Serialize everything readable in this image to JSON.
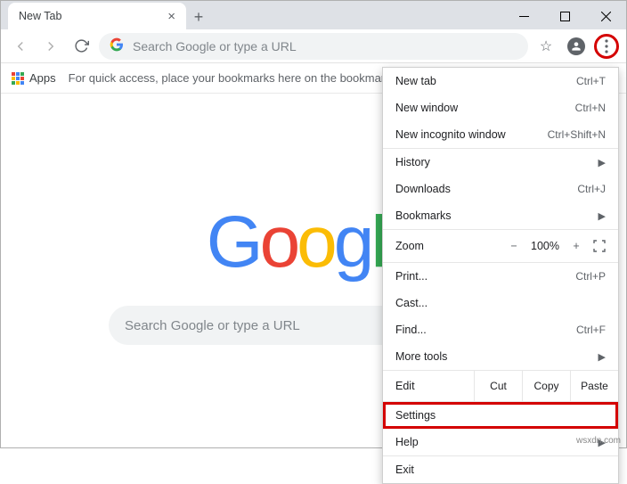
{
  "window": {
    "tab_title": "New Tab"
  },
  "toolbar": {
    "omnibox_placeholder": "Search Google or type a URL"
  },
  "bookmarks_bar": {
    "apps_label": "Apps",
    "hint": "For quick access, place your bookmarks here on the bookmarks ba"
  },
  "ntp": {
    "search_placeholder": "Search Google or type a URL"
  },
  "menu": {
    "new_tab": {
      "label": "New tab",
      "shortcut": "Ctrl+T"
    },
    "new_window": {
      "label": "New window",
      "shortcut": "Ctrl+N"
    },
    "incognito": {
      "label": "New incognito window",
      "shortcut": "Ctrl+Shift+N"
    },
    "history": {
      "label": "History"
    },
    "downloads": {
      "label": "Downloads",
      "shortcut": "Ctrl+J"
    },
    "bookmarks": {
      "label": "Bookmarks"
    },
    "zoom": {
      "label": "Zoom",
      "minus": "−",
      "value": "100%",
      "plus": "+"
    },
    "print": {
      "label": "Print...",
      "shortcut": "Ctrl+P"
    },
    "cast": {
      "label": "Cast..."
    },
    "find": {
      "label": "Find...",
      "shortcut": "Ctrl+F"
    },
    "more_tools": {
      "label": "More tools"
    },
    "edit": {
      "label": "Edit",
      "cut": "Cut",
      "copy": "Copy",
      "paste": "Paste"
    },
    "settings": {
      "label": "Settings"
    },
    "help": {
      "label": "Help"
    },
    "exit": {
      "label": "Exit"
    }
  },
  "watermark": "wsxdn.com"
}
